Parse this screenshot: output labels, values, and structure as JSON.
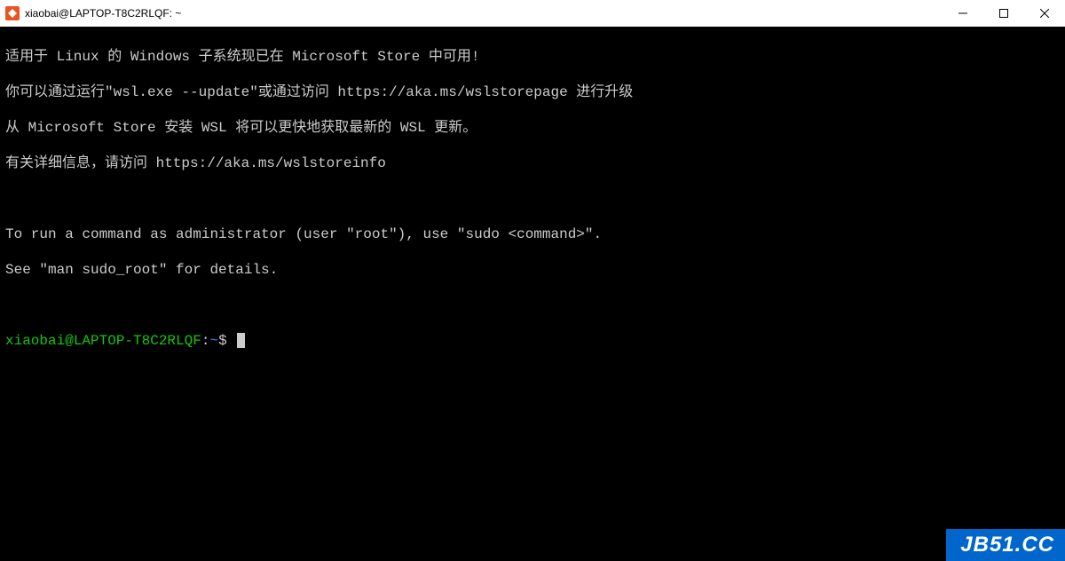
{
  "titlebar": {
    "title": "xiaobai@LAPTOP-T8C2RLQF: ~"
  },
  "terminal": {
    "lines": {
      "l1": "适用于 Linux 的 Windows 子系统现已在 Microsoft Store 中可用!",
      "l2": "你可以通过运行\"wsl.exe --update\"或通过访问 https://aka.ms/wslstorepage 进行升级",
      "l3": "从 Microsoft Store 安装 WSL 将可以更快地获取最新的 WSL 更新。",
      "l4": "有关详细信息，请访问 https://aka.ms/wslstoreinfo",
      "l5": "",
      "l6": "To run a command as administrator (user \"root\"), use \"sudo <command>\".",
      "l7": "See \"man sudo_root\" for details.",
      "l8": ""
    },
    "prompt": {
      "userhost": "xiaobai@LAPTOP-T8C2RLQF",
      "sep": ":",
      "path": "~",
      "symbol": "$"
    }
  },
  "watermark": "JB51.CC"
}
